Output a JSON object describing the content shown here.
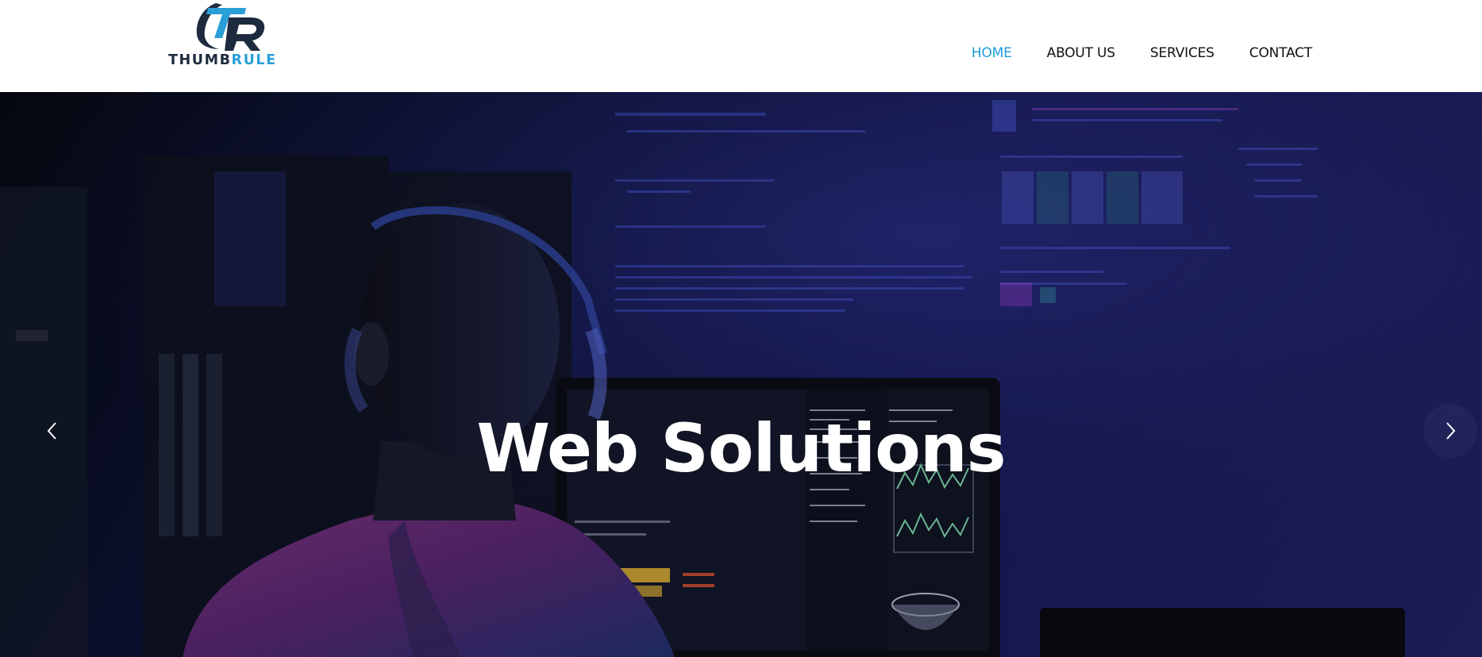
{
  "brand": {
    "logo_text_part1": "THUMB",
    "logo_text_part2": "RULE",
    "colors": {
      "dark": "#1e2b3e",
      "accent": "#2a9fd6"
    }
  },
  "nav": {
    "items": [
      {
        "label": "HOME",
        "active": true
      },
      {
        "label": "ABOUT US",
        "active": false
      },
      {
        "label": "SERVICES",
        "active": false
      },
      {
        "label": "CONTACT",
        "active": false
      }
    ],
    "active_color": "#1c9ad6"
  },
  "hero": {
    "title": "Web Solutions",
    "prev_icon": "chevron-left-icon",
    "next_icon": "chevron-right-icon"
  }
}
